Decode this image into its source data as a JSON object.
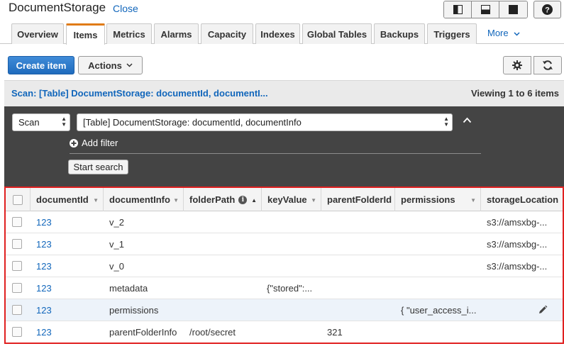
{
  "header": {
    "title": "DocumentStorage",
    "close_label": "Close"
  },
  "tabs": {
    "items": [
      "Overview",
      "Items",
      "Metrics",
      "Alarms",
      "Capacity",
      "Indexes",
      "Global Tables",
      "Backups",
      "Triggers"
    ],
    "active": "Items",
    "more_label": "More"
  },
  "toolbar": {
    "create_label": "Create item",
    "actions_label": "Actions"
  },
  "scan_bar": {
    "summary": "Scan: [Table] DocumentStorage: documentId, documentI...",
    "viewing": "Viewing 1 to 6 items"
  },
  "filter": {
    "mode_value": "Scan",
    "target_value": "[Table] DocumentStorage: documentId, documentInfo",
    "add_filter_label": "Add filter",
    "start_search_label": "Start search"
  },
  "table": {
    "columns": [
      "documentId",
      "documentInfo",
      "folderPath",
      "keyValue",
      "parentFolderId",
      "permissions",
      "storageLocation"
    ],
    "rows": [
      {
        "documentId": "123",
        "documentInfo": "v_2",
        "folderPath": "",
        "keyValue": "",
        "parentFolderId": "",
        "permissions": "",
        "storageLocation": "s3://amsxbg-..."
      },
      {
        "documentId": "123",
        "documentInfo": "v_1",
        "folderPath": "",
        "keyValue": "",
        "parentFolderId": "",
        "permissions": "",
        "storageLocation": "s3://amsxbg-..."
      },
      {
        "documentId": "123",
        "documentInfo": "v_0",
        "folderPath": "",
        "keyValue": "",
        "parentFolderId": "",
        "permissions": "",
        "storageLocation": "s3://amsxbg-..."
      },
      {
        "documentId": "123",
        "documentInfo": "metadata",
        "folderPath": "",
        "keyValue": "{\"stored\":...",
        "parentFolderId": "",
        "permissions": "",
        "storageLocation": ""
      },
      {
        "documentId": "123",
        "documentInfo": "permissions",
        "folderPath": "",
        "keyValue": "",
        "parentFolderId": "",
        "permissions": "{ \"user_access_i...",
        "storageLocation": ""
      },
      {
        "documentId": "123",
        "documentInfo": "parentFolderInfo",
        "folderPath": "/root/secret",
        "keyValue": "",
        "parentFolderId": "321",
        "permissions": "",
        "storageLocation": ""
      }
    ],
    "hover_row": 4
  },
  "icons": {
    "view_toggle": [
      "split-left-icon",
      "split-bottom-icon",
      "full-screen-icon"
    ],
    "help": "help-icon",
    "gear": "gear-icon",
    "refresh": "refresh-icon",
    "collapse": "chevron-up-icon",
    "add_filter": "plus-circle-icon",
    "info": "info-icon",
    "edit": "pencil-icon"
  },
  "colors": {
    "accent": "#e07b17",
    "link": "#1166bb",
    "primary_button": "#1f6bbd",
    "highlight_border": "#e02020",
    "filter_panel": "#444444"
  }
}
